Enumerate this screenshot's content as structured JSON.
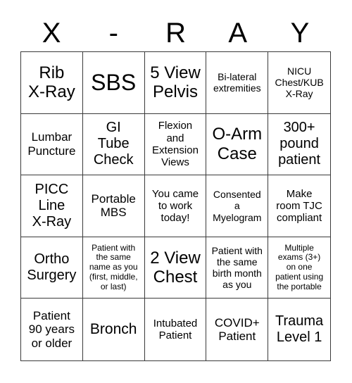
{
  "title_letters": [
    "X",
    "-",
    "R",
    "A",
    "Y"
  ],
  "cells": [
    {
      "text": "Rib\nX-Ray"
    },
    {
      "text": "SBS"
    },
    {
      "text": "5 View\nPelvis"
    },
    {
      "text": "Bi-lateral\nextremities"
    },
    {
      "text": "NICU\nChest/KUB\nX-Ray"
    },
    {
      "text": "Lumbar\nPuncture"
    },
    {
      "text": "GI\nTube\nCheck"
    },
    {
      "text": "Flexion\nand\nExtension\nViews"
    },
    {
      "text": "O-Arm\nCase"
    },
    {
      "text": "300+\npound\npatient"
    },
    {
      "text": "PICC\nLine\nX-Ray"
    },
    {
      "text": "Portable\nMBS"
    },
    {
      "text": "You came\nto work\ntoday!"
    },
    {
      "text": "Consented\na\nMyelogram"
    },
    {
      "text": "Make\nroom TJC\ncompliant"
    },
    {
      "text": "Ortho\nSurgery"
    },
    {
      "text": "Patient with\nthe same\nname as you\n(first, middle,\nor last)"
    },
    {
      "text": "2 View\nChest"
    },
    {
      "text": "Patient with\nthe same\nbirth month\nas you"
    },
    {
      "text": "Multiple\nexams (3+)\non one\npatient using\nthe portable"
    },
    {
      "text": "Patient\n90 years\nor older"
    },
    {
      "text": "Bronch"
    },
    {
      "text": "Intubated\nPatient"
    },
    {
      "text": "COVID+\nPatient"
    },
    {
      "text": "Trauma\nLevel 1"
    }
  ]
}
